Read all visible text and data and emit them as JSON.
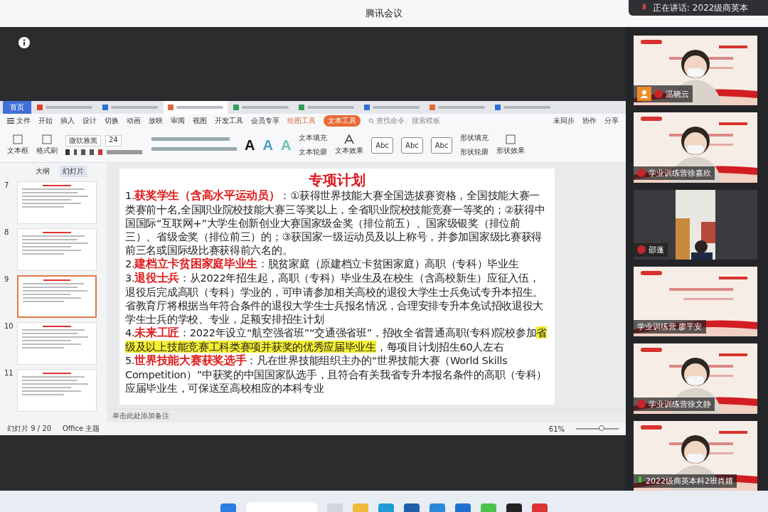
{
  "meeting": {
    "title": "腾讯会议",
    "speaking_toast": "正在讲话: 2022级商英本"
  },
  "wps": {
    "home_tab": "首页",
    "doc_tabs": [
      {
        "color": "#d9412f",
        "selected": false
      },
      {
        "color": "#2f6fd9",
        "selected": false
      },
      {
        "color": "#e06a3a",
        "selected": true
      },
      {
        "color": "#2ea05a",
        "selected": false
      },
      {
        "color": "#2ea05a",
        "selected": false
      },
      {
        "color": "#2f6fd9",
        "selected": false
      },
      {
        "color": "#e06a3a",
        "selected": false
      },
      {
        "color": "#2f6fd9",
        "selected": false
      }
    ],
    "file_menu": "文件",
    "menus": [
      {
        "label": "开始",
        "kind": "plain",
        "selected": false
      },
      {
        "label": "插入",
        "kind": "plain",
        "selected": false
      },
      {
        "label": "设计",
        "kind": "plain",
        "selected": false
      },
      {
        "label": "切换",
        "kind": "plain",
        "selected": false
      },
      {
        "label": "动画",
        "kind": "plain",
        "selected": false
      },
      {
        "label": "放映",
        "kind": "plain",
        "selected": false
      },
      {
        "label": "审阅",
        "kind": "plain",
        "selected": false
      },
      {
        "label": "视图",
        "kind": "plain",
        "selected": false
      },
      {
        "label": "开发工具",
        "kind": "plain",
        "selected": false
      },
      {
        "label": "会员专享",
        "kind": "plain",
        "selected": false
      },
      {
        "label": "绘图工具",
        "kind": "context",
        "selected": false
      },
      {
        "label": "文本工具",
        "kind": "context",
        "selected": true
      }
    ],
    "search_placeholder": "查找命令、搜索模板",
    "right_actions": [
      "未同步",
      "协作",
      "分享"
    ],
    "ribbon": {
      "left_tools": [
        "文本框",
        "格式刷"
      ],
      "font": "微软雅黑",
      "size": "24",
      "text_styles": [
        "A",
        "A",
        "A"
      ],
      "style_samples": [
        "Abc",
        "Abc",
        "Abc"
      ],
      "text_labels": [
        "文本填充",
        "文本轮廓"
      ],
      "text_effect": "文本效果",
      "shape_labels": [
        "形状填充",
        "形状轮廓"
      ],
      "shape_effect": "形状效果"
    },
    "panel_tabs": [
      {
        "label": "大纲",
        "selected": false
      },
      {
        "label": "幻灯片",
        "selected": true
      }
    ],
    "thumbnails": [
      {
        "number": "7",
        "selected": false
      },
      {
        "number": "8",
        "selected": false
      },
      {
        "number": "9",
        "selected": true
      },
      {
        "number": "10",
        "selected": false
      },
      {
        "number": "11",
        "selected": false
      }
    ],
    "slide": {
      "title": "专项计划",
      "items": [
        "1.**获奖学生（含高水平运动员）**：①获得世界技能大赛全国选拔赛资格，全国技能大赛一类赛前十名,全国职业院校技能大赛三等奖以上，全省职业院校技能竞赛一等奖的；②获得中国国际“互联网+”大学生创新创业大赛国家级金奖（排位前五）、国家级银奖（排位前三）、省级金奖（排位前三）的；③获国家一级运动员及以上称号，并参加国家级比赛获得前三名或国际级比赛获得前六名的。",
        "2.**建档立卡贫困家庭毕业生**：脱贫家庭（原建档立卡贫困家庭）高职（专科）毕业生",
        "3.**退役士兵**：从2022年招生起，高职（专科）毕业生及在校生（含高校新生）应征入伍，退役后完成高职（专科）学业的，可申请参加相关高校的退役大学生士兵免试专升本招生。省教育厅将根据当年符合条件的退役大学生士兵报名情况，合理安排专升本免试招收退役大学生士兵的学校、专业，足额安排招生计划",
        {
          "text": "4.**未来工匠**：2022年设立“航空强省班”“交通强省班”，招收全省普通高职(专科)院校参加",
          "highlight": "省级及以上技能竞赛工科类赛项并获奖的优秀应届毕业生",
          "after": "，每项目计划招生60人左右"
        },
        "5.**世界技能大赛获奖选手**：凡在世界技能组织主办的“世界技能大赛（World Skills Competition）”中获奖的中国国家队选手，且符合有关我省专升本报名条件的高职（专科）应届毕业生，可保送至高校相应的本科专业"
      ]
    },
    "notes_placeholder": "单击此处添加备注",
    "status": {
      "slide": "幻灯片 9 / 20",
      "theme": "Office 主题",
      "zoom": "61%",
      "zoom_slider": {
        "level": 0.6
      }
    }
  },
  "participants": [
    {
      "name": "温晓云",
      "kind": "camera",
      "avatar_badge": true,
      "speaking": false
    },
    {
      "name": "学业训练营徐嘉欣",
      "kind": "camera",
      "avatar_badge": false,
      "speaking": false
    },
    {
      "name": "邵蓬",
      "kind": "portrait",
      "avatar_badge": false,
      "speaking": false
    },
    {
      "name": "学业训练营 廖平安",
      "kind": "slide"
    },
    {
      "name": "学业训练营徐文静",
      "kind": "camera",
      "avatar_badge": false,
      "speaking": false
    },
    {
      "name": "2022级商英本科2班肖婧",
      "kind": "camera",
      "avatar_badge": false,
      "speaking": true
    }
  ]
}
